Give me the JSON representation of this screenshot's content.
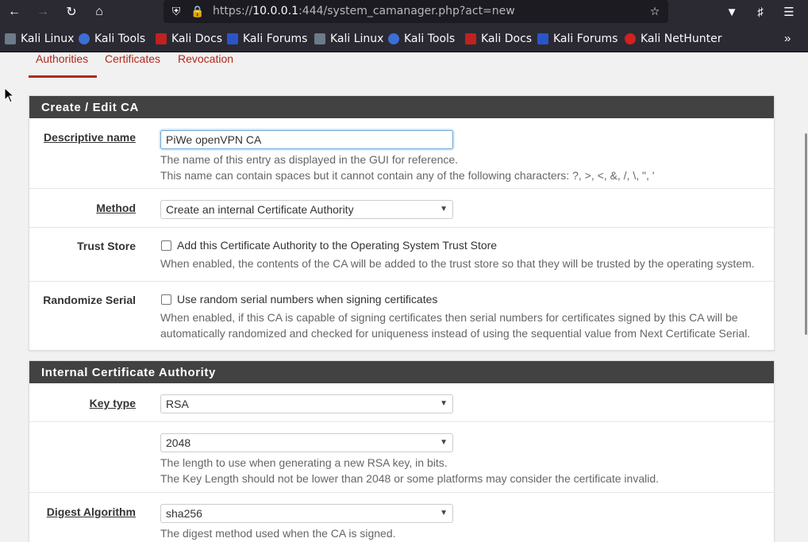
{
  "browser": {
    "url_prefix": "https://",
    "url_host": "10.0.0.1",
    "url_rest": ":444/system_camanager.php?act=new",
    "bookmarks": [
      {
        "label": "Kali Linux",
        "icon": "kali-dragon-icon"
      },
      {
        "label": "Kali Tools",
        "icon": "kali-tools-icon"
      },
      {
        "label": "Kali Docs",
        "icon": "kali-docs-icon"
      },
      {
        "label": "Kali Forums",
        "icon": "kali-forums-icon"
      },
      {
        "label": "Kali Linux",
        "icon": "kali-dragon-icon"
      },
      {
        "label": "Kali Tools",
        "icon": "kali-tools-icon"
      },
      {
        "label": "Kali Docs",
        "icon": "kali-docs-icon"
      },
      {
        "label": "Kali Forums",
        "icon": "kali-forums-icon"
      },
      {
        "label": "Kali NetHunter",
        "icon": "kali-nethunter-icon"
      }
    ]
  },
  "tabs": [
    "Authorities",
    "Certificates",
    "Revocation"
  ],
  "create_panel": {
    "title": "Create / Edit CA",
    "descriptive_name": {
      "label": "Descriptive name",
      "value": "PiWe openVPN CA",
      "help1": "The name of this entry as displayed in the GUI for reference.",
      "help2": "This name can contain spaces but it cannot contain any of the following characters: ?, >, <, &, /, \\, \", '"
    },
    "method": {
      "label": "Method",
      "value": "Create an internal Certificate Authority"
    },
    "trust_store": {
      "label": "Trust Store",
      "checkbox": "Add this Certificate Authority to the Operating System Trust Store",
      "checked": false,
      "help": "When enabled, the contents of the CA will be added to the trust store so that they will be trusted by the operating system."
    },
    "randomize_serial": {
      "label": "Randomize Serial",
      "checkbox": "Use random serial numbers when signing certificates",
      "checked": false,
      "help1": "When enabled, if this CA is capable of signing certificates then serial numbers for certificates signed by this CA will be",
      "help2": "automatically randomized and checked for uniqueness instead of using the sequential value from Next Certificate Serial."
    }
  },
  "internal_panel": {
    "title": "Internal Certificate Authority",
    "key_type": {
      "label": "Key type",
      "value": "RSA"
    },
    "key_length": {
      "value": "2048",
      "help1": "The length to use when generating a new RSA key, in bits.",
      "help2": "The Key Length should not be lower than 2048 or some platforms may consider the certificate invalid."
    },
    "digest": {
      "label": "Digest Algorithm",
      "value": "sha256",
      "help": "The digest method used when the CA is signed."
    }
  },
  "colors": {
    "accent": "#b0281a",
    "panel_header": "#424242"
  }
}
